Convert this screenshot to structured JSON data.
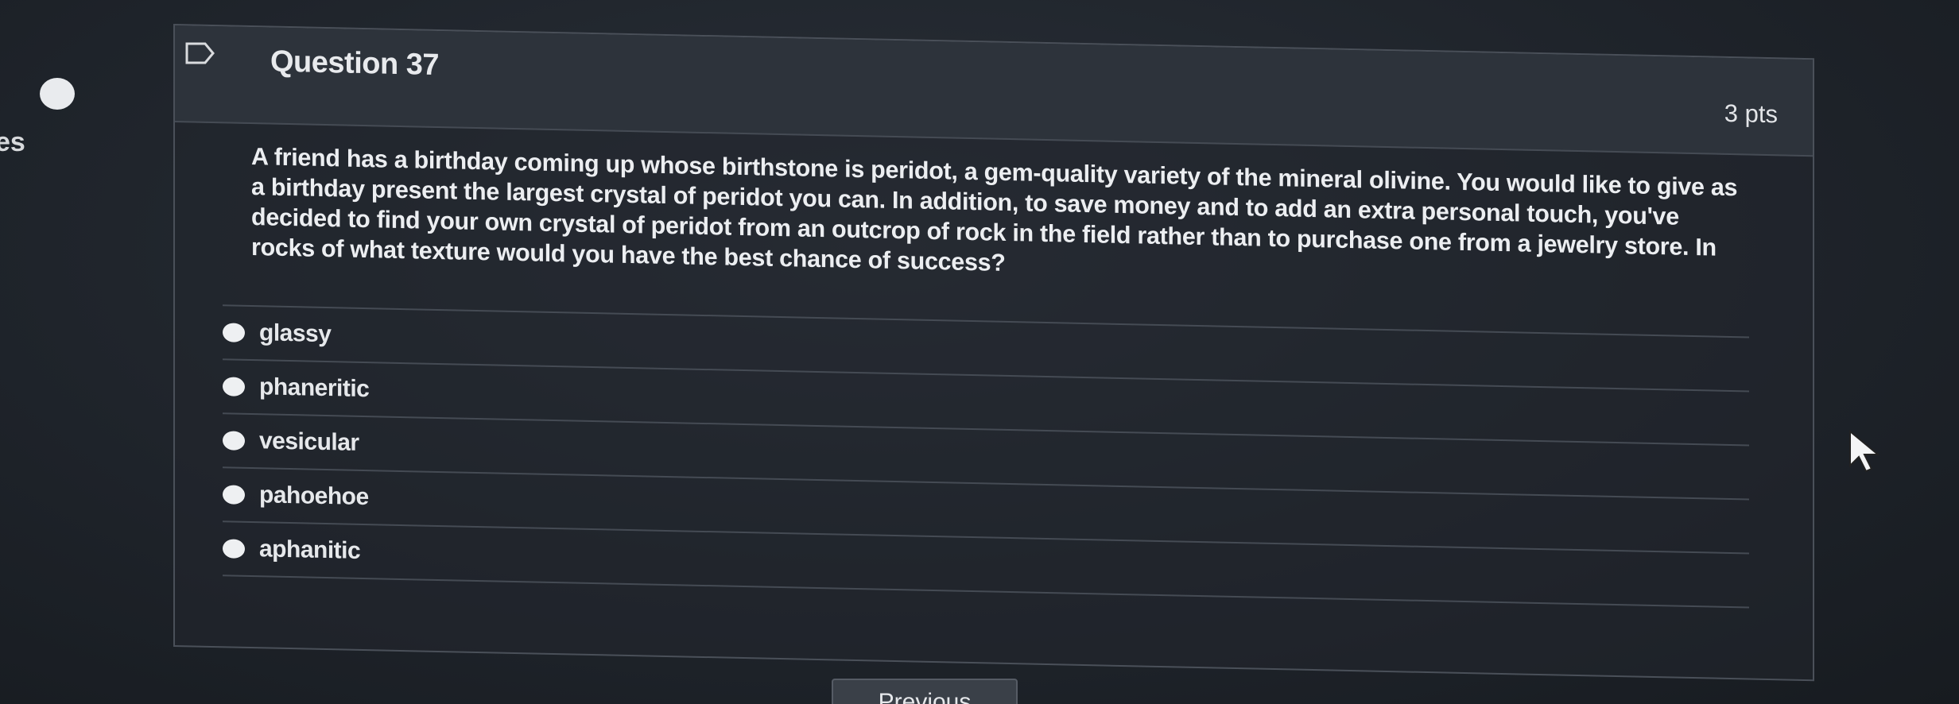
{
  "left_edge": {
    "text": "es"
  },
  "question": {
    "title": "Question 37",
    "points": "3 pts",
    "text": "A friend has a birthday coming up whose birthstone is peridot, a gem-quality variety of the mineral olivine.  You would like to give as a birthday present the largest crystal of peridot you can.  In addition, to save money and to add an extra personal touch, you've decided to find your own crystal of peridot from an outcrop of rock in the field rather than to purchase one from a jewelry store.  In rocks of what texture would you have the best chance of success?",
    "answers": [
      {
        "label": "glassy"
      },
      {
        "label": "phaneritic"
      },
      {
        "label": "vesicular"
      },
      {
        "label": "pahoehoe"
      },
      {
        "label": "aphanitic"
      }
    ]
  },
  "navigation": {
    "previous_label": "Previous"
  },
  "icons": {
    "flag": "flag-icon",
    "cursor": "mouse-cursor-icon"
  },
  "colors": {
    "background": "#1f242b",
    "header": "#2d333b",
    "text": "#eceef1",
    "radio": "#eef0f2"
  }
}
